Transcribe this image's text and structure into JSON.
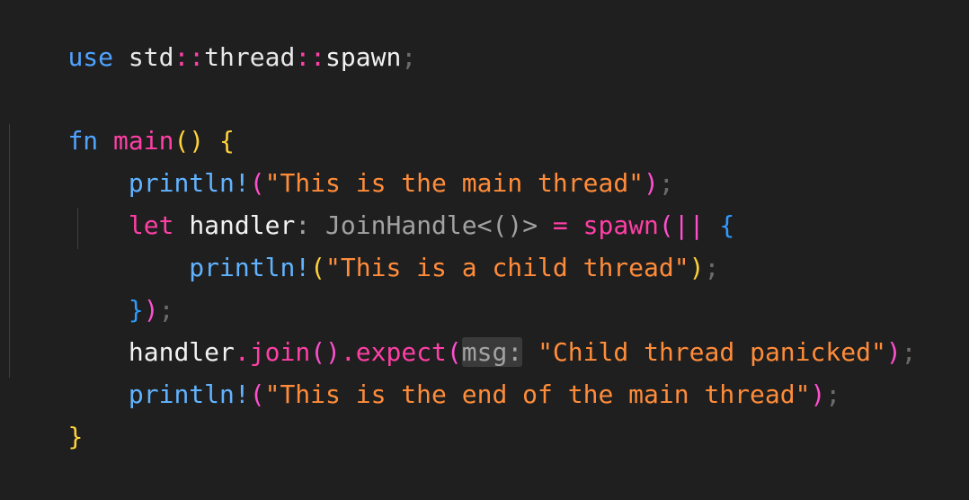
{
  "code": {
    "line1": {
      "use": "use",
      "std": "std",
      "sep1": "::",
      "thread": "thread",
      "sep2": "::",
      "spawn": "spawn",
      "semi": ";"
    },
    "line3": {
      "fn": "fn",
      "main": "main",
      "parens": "()",
      "brace": "{"
    },
    "line4": {
      "macro": "println!",
      "open": "(",
      "str": "\"This is the main thread\"",
      "close": ")",
      "semi": ";"
    },
    "line5": {
      "let": "let",
      "var": "handler",
      "hint": ": JoinHandle<()>",
      "eq": "=",
      "spawn": "spawn",
      "open": "(",
      "bars": "||",
      "brace": "{"
    },
    "line6": {
      "macro": "println!",
      "open": "(",
      "str": "\"This is a child thread\"",
      "close": ")",
      "semi": ";"
    },
    "line7": {
      "brace": "}",
      "close": ")",
      "semi": ";"
    },
    "line8": {
      "var": "handler",
      "dot1": ".",
      "join": "join",
      "parens": "()",
      "dot2": ".",
      "expect": "expect",
      "open": "(",
      "hint": "msg:",
      "str": "\"Child thread panicked\"",
      "close": ")",
      "semi": ";"
    },
    "line9": {
      "macro": "println!",
      "open": "(",
      "str": "\"This is the end of the main thread\"",
      "close": ")",
      "semi": ";"
    },
    "line10": {
      "brace": "}"
    }
  }
}
